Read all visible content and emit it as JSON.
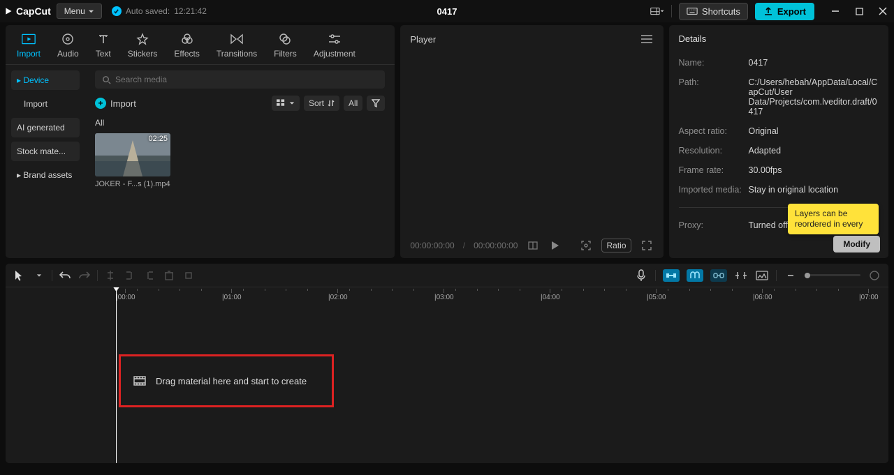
{
  "titlebar": {
    "app": "CapCut",
    "menu": "Menu",
    "autosave_prefix": "Auto saved:",
    "autosave_time": "12:21:42",
    "project_title": "0417",
    "shortcuts": "Shortcuts",
    "export": "Export"
  },
  "media_tabs": [
    {
      "id": "import",
      "label": "Import"
    },
    {
      "id": "audio",
      "label": "Audio"
    },
    {
      "id": "text",
      "label": "Text"
    },
    {
      "id": "stickers",
      "label": "Stickers"
    },
    {
      "id": "effects",
      "label": "Effects"
    },
    {
      "id": "transitions",
      "label": "Transitions"
    },
    {
      "id": "filters",
      "label": "Filters"
    },
    {
      "id": "adjustment",
      "label": "Adjustment"
    }
  ],
  "media_sidebar": [
    {
      "label": "Device",
      "active": true,
      "caret": true
    },
    {
      "label": "Import",
      "plain": true
    },
    {
      "label": "AI generated"
    },
    {
      "label": "Stock mate..."
    },
    {
      "label": "Brand assets",
      "caret": true
    }
  ],
  "media_main": {
    "search_placeholder": "Search media",
    "import_label": "Import",
    "sort_label": "Sort",
    "all_label": "All",
    "section_label": "All",
    "clip": {
      "duration": "02:25",
      "name": "JOKER - F...s (1).mp4"
    }
  },
  "player": {
    "title": "Player",
    "time_current": "00:00:00:00",
    "time_total": "00:00:00:00",
    "ratio_badge": "Ratio"
  },
  "details": {
    "title": "Details",
    "rows": [
      {
        "k": "Name:",
        "v": "0417"
      },
      {
        "k": "Path:",
        "v": "C:/Users/hebah/AppData/Local/CapCut/User Data/Projects/com.lveditor.draft/0417"
      },
      {
        "k": "Aspect ratio:",
        "v": "Original"
      },
      {
        "k": "Resolution:",
        "v": "Adapted"
      },
      {
        "k": "Frame rate:",
        "v": "30.00fps"
      },
      {
        "k": "Imported media:",
        "v": "Stay in original location"
      },
      {
        "k": "Proxy:",
        "v": "Turned off"
      }
    ],
    "modify": "Modify",
    "tooltip": "Layers can be reordered in every"
  },
  "timeline": {
    "ticks": [
      "00:00",
      "01:00",
      "02:00",
      "03:00",
      "04:00",
      "05:00",
      "06:00",
      "07:00"
    ],
    "drop_hint": "Drag material here and start to create"
  }
}
